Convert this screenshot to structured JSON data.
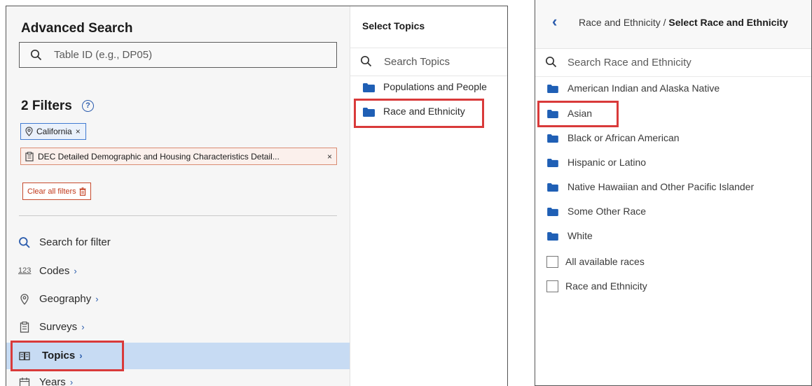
{
  "advanced_search": {
    "title": "Advanced Search",
    "table_search_placeholder": "Table ID (e.g., DP05)",
    "filters_heading": "2 Filters",
    "help_icon": "question-circle-icon",
    "chips": [
      {
        "label": "California",
        "icon": "map-pin-icon"
      },
      {
        "label": "DEC Detailed Demographic and Housing Characteristics Detail...",
        "icon": "clipboard-icon"
      }
    ],
    "clear_all_label": "Clear all filters",
    "nav": [
      {
        "label": "Search for filter",
        "icon": "search-icon",
        "chevron": ""
      },
      {
        "label": "Codes",
        "icon": "123",
        "chevron": "›"
      },
      {
        "label": "Geography",
        "icon": "map-pin-icon",
        "chevron": "›"
      },
      {
        "label": "Surveys",
        "icon": "clipboard-icon",
        "chevron": "›"
      },
      {
        "label": "Topics",
        "icon": "book-icon",
        "chevron": "›",
        "selected": true
      },
      {
        "label": "Years",
        "icon": "calendar-icon",
        "chevron": "›"
      }
    ]
  },
  "select_topics": {
    "title": "Select Topics",
    "search_placeholder": "Search Topics",
    "items": [
      "Populations and People",
      "Race and Ethnicity"
    ]
  },
  "race_panel": {
    "back_icon": "chevron-left-icon",
    "crumb_parent": "Race and Ethnicity",
    "crumb_separator": " / ",
    "crumb_current": "Select Race and Ethnicity",
    "search_placeholder": "Search Race and Ethnicity",
    "folders": [
      "American Indian and Alaska Native",
      "Asian",
      "Black or African American",
      "Hispanic or Latino",
      "Native Hawaiian and Other Pacific Islander",
      "Some Other Race",
      "White"
    ],
    "checkboxes": [
      "All available races",
      "Race and Ethnicity"
    ]
  },
  "colors": {
    "accent_blue": "#2b5cad",
    "folder_blue": "#1f5fb5",
    "selected_row": "#c7dbf3",
    "highlight_red": "#d93a3a",
    "clear_red": "#c1391b"
  }
}
